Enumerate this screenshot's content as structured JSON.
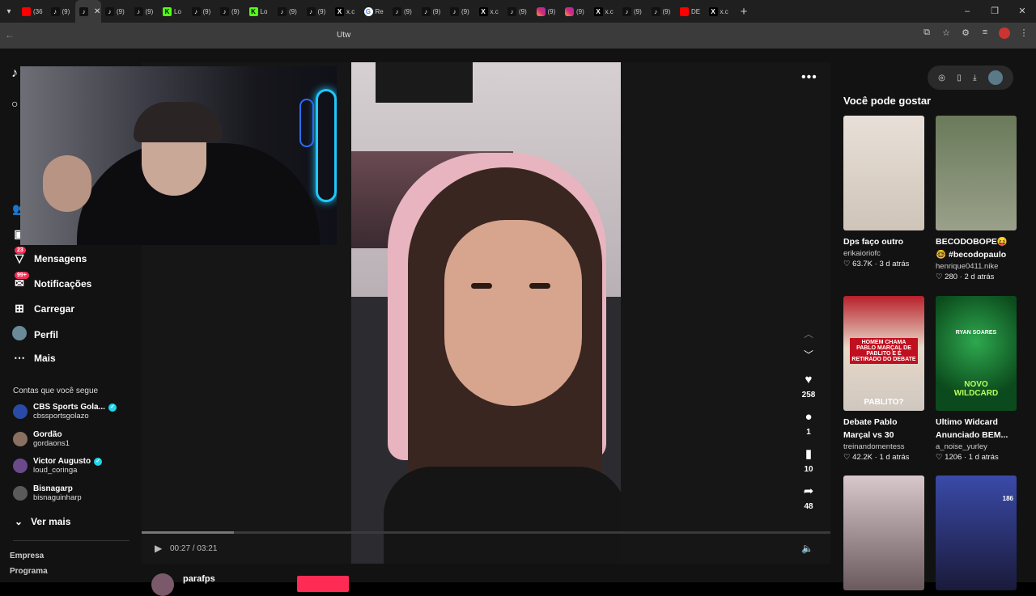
{
  "browser": {
    "tabs": [
      {
        "icon": "youtube-icon",
        "label": "(36"
      },
      {
        "icon": "tiktok-icon",
        "label": "(9)"
      },
      {
        "icon": "tiktok-icon",
        "label": "",
        "active": true
      },
      {
        "icon": "tiktok-icon",
        "label": "(9)"
      },
      {
        "icon": "tiktok-icon",
        "label": "(9)"
      },
      {
        "icon": "kick-icon",
        "label": "Lo"
      },
      {
        "icon": "tiktok-icon",
        "label": "(9)"
      },
      {
        "icon": "tiktok-icon",
        "label": "(9)"
      },
      {
        "icon": "kick-icon",
        "label": "Lo"
      },
      {
        "icon": "tiktok-icon",
        "label": "(9)"
      },
      {
        "icon": "tiktok-icon",
        "label": "(9)"
      },
      {
        "icon": "x-icon",
        "label": "x.c"
      },
      {
        "icon": "google-icon",
        "label": "Re"
      },
      {
        "icon": "tiktok-icon",
        "label": "(9)"
      },
      {
        "icon": "tiktok-icon",
        "label": "(9)"
      },
      {
        "icon": "tiktok-icon",
        "label": "(9)"
      },
      {
        "icon": "x-icon",
        "label": "x.c"
      },
      {
        "icon": "tiktok-icon",
        "label": "(9)"
      },
      {
        "icon": "instagram-icon",
        "label": "(9)"
      },
      {
        "icon": "instagram-icon",
        "label": "(9)"
      },
      {
        "icon": "x-icon",
        "label": "x.c"
      },
      {
        "icon": "tiktok-icon",
        "label": "(9)"
      },
      {
        "icon": "tiktok-icon",
        "label": "(9)"
      },
      {
        "icon": "youtube-icon",
        "label": "DE"
      },
      {
        "icon": "x-icon",
        "label": "x.c"
      }
    ],
    "address": "Utw"
  },
  "sidebar": {
    "nav": [
      {
        "icon": "friends-icon",
        "label": "Amigos"
      },
      {
        "icon": "live-icon",
        "label": "LIVE"
      },
      {
        "icon": "messages-icon",
        "label": "Mensagens",
        "badge": "23"
      },
      {
        "icon": "notifications-icon",
        "label": "Notificações",
        "badge": "99+"
      },
      {
        "icon": "upload-icon",
        "label": "Carregar"
      },
      {
        "icon": "profile-icon",
        "label": "Perfil"
      },
      {
        "icon": "more-icon",
        "label": "Mais"
      }
    ],
    "following_title": "Contas que você segue",
    "following": [
      {
        "name": "CBS Sports Gola...",
        "user": "cbssportsgolazo",
        "verified": true,
        "color": "#2a4aa8"
      },
      {
        "name": "Gordão",
        "user": "gordaons1",
        "verified": false,
        "color": "#8a7060"
      },
      {
        "name": "Victor Augusto",
        "user": "loud_coringa",
        "verified": true,
        "color": "#6a4a8a"
      },
      {
        "name": "Bisnagarp",
        "user": "bisnaguinharp",
        "verified": false,
        "color": "#5a5a5a"
      }
    ],
    "see_more": "Ver mais",
    "footer": [
      "Empresa",
      "Programa"
    ]
  },
  "video": {
    "likes": "258",
    "comments": "1",
    "saves": "10",
    "shares": "48",
    "time": "00:27 / 03:21",
    "progress": 0.134,
    "author": "parafps"
  },
  "recommendations": {
    "title": "Você pode gostar",
    "items": [
      {
        "title": "Dps faço outro",
        "user": "erikaioriofc",
        "likes": "63.7K",
        "ago": "3 d atrás",
        "thumb": "t1"
      },
      {
        "title": "BECODOBOPE😝 🤓 #becodopaulo #au...",
        "user": "henrique0411.nike",
        "likes": "280",
        "ago": "2 d atrás",
        "thumb": "t2"
      },
      {
        "title": "Debate Pablo Marçal vs 30 pobres...",
        "user": "treinandomentess",
        "likes": "42.2K",
        "ago": "1 d atrás",
        "thumb": "t3"
      },
      {
        "title": "Ultimo Widcard Anunciado BEM...",
        "user": "a_noise_yurley",
        "likes": "1206",
        "ago": "1 d atrás",
        "thumb": "t4"
      },
      {
        "title": "",
        "user": "",
        "likes": "",
        "ago": "",
        "thumb": "t5"
      },
      {
        "title": "",
        "user": "",
        "likes": "",
        "ago": "",
        "thumb": "t6"
      }
    ],
    "thumb_text": {
      "t3_top": "HOMEM CHAMA PABLO MARÇAL DE PABLITO E É RETIRADO DO DEBATE",
      "t3_bottom": "PABLITO?",
      "t4_top": "RYAN SOARES",
      "t4_bottom": "NOVO WILDCARD",
      "t6_num": "186"
    }
  }
}
